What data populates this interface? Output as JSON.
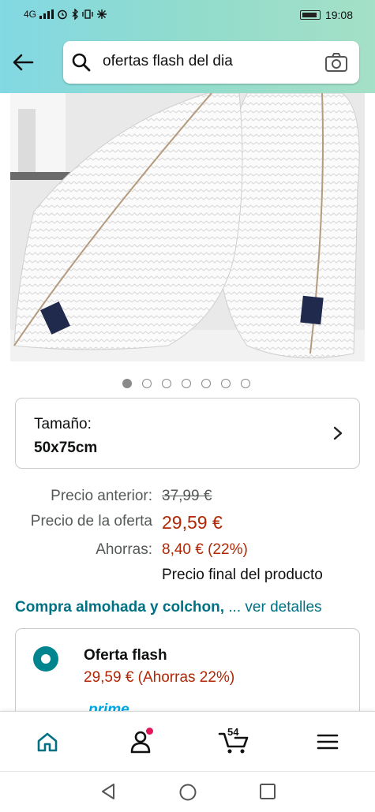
{
  "status_bar": {
    "network": "4G",
    "time": "19:08"
  },
  "header": {
    "back_icon": "back-arrow-icon",
    "search_query": "ofertas flash del dia",
    "search_icon": "search-icon",
    "camera_icon": "camera-icon"
  },
  "gallery": {
    "image_count": 7,
    "active_index": 0
  },
  "size_selector": {
    "label": "Tamaño:",
    "value": "50x75cm"
  },
  "pricing": {
    "previous_label": "Precio anterior:",
    "previous_value": "37,99 €",
    "deal_label": "Precio de la oferta",
    "deal_value": "29,59 €",
    "savings_label": "Ahorras:",
    "savings_value": "8,40 € (22%)",
    "final_note": "Precio final del producto"
  },
  "bundle_link": {
    "bold": "Compra almohada y colchon,",
    "rest": "... ver detalles"
  },
  "offer_option": {
    "title": "Oferta flash",
    "price_line": "29,59 € (Ahorras 22%)",
    "prime_label": "prime"
  },
  "bottom_nav": {
    "cart_count": "54",
    "items": [
      "home-icon",
      "account-icon",
      "cart-icon",
      "menu-icon"
    ]
  },
  "colors": {
    "price_red": "#b12704",
    "link_teal": "#007185",
    "radio_teal": "#00848e",
    "header_gradient_start": "#82d8e3",
    "header_gradient_end": "#a5e0c8"
  }
}
